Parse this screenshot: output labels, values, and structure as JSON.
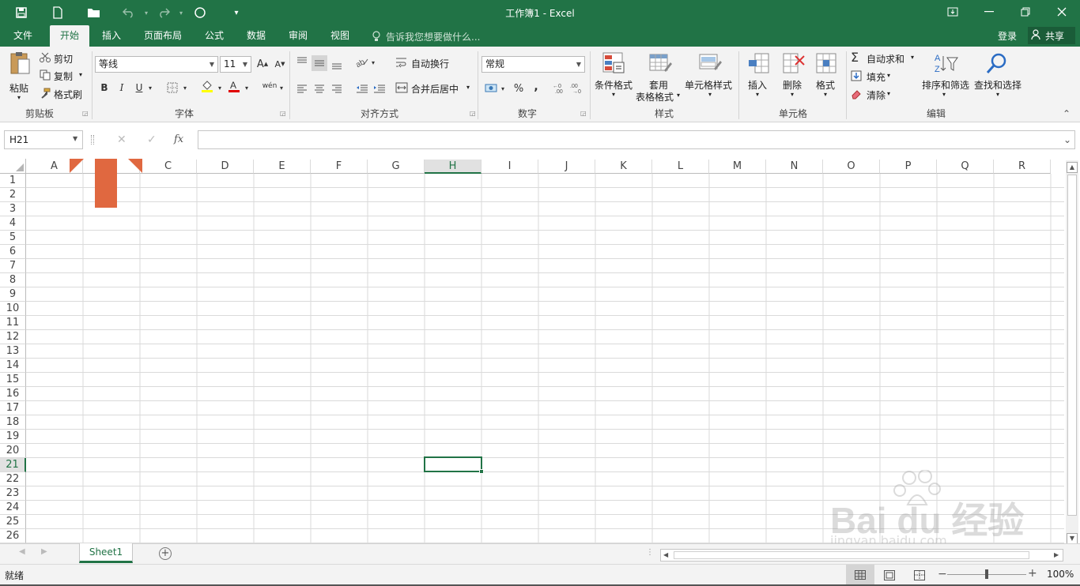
{
  "window": {
    "title": "工作簿1 - Excel"
  },
  "tabs": [
    "文件",
    "开始",
    "插入",
    "页面布局",
    "公式",
    "数据",
    "审阅",
    "视图"
  ],
  "tell_me": "告诉我您想要做什么...",
  "account": {
    "login": "登录",
    "share": "共享"
  },
  "ribbon": {
    "clipboard": {
      "paste": "粘贴",
      "cut": "剪切",
      "copy": "复制",
      "format_painter": "格式刷",
      "label": "剪贴板"
    },
    "font": {
      "name": "等线",
      "size": "11",
      "bold": "B",
      "italic": "I",
      "underline": "U",
      "grow": "A",
      "shrink": "A",
      "phonetic": "wén",
      "label": "字体"
    },
    "alignment": {
      "wrap": "自动换行",
      "merge": "合并后居中",
      "label": "对齐方式"
    },
    "number": {
      "format": "常规",
      "percent": "%",
      "comma": ",",
      "label": "数字"
    },
    "styles": {
      "conditional": "条件格式",
      "table1": "套用",
      "table2": "表格格式",
      "cell_styles": "单元格样式",
      "label": "样式"
    },
    "cells": {
      "insert": "插入",
      "delete": "删除",
      "format": "格式",
      "label": "单元格"
    },
    "editing": {
      "autosum": "自动求和",
      "fill": "填充",
      "clear": "清除",
      "sort": "排序和筛选",
      "find": "查找和选择",
      "label": "编辑"
    }
  },
  "formula_bar": {
    "name_box": "H21",
    "fx": "fx",
    "content": ""
  },
  "grid": {
    "columns": [
      "A",
      "B",
      "C",
      "D",
      "E",
      "F",
      "G",
      "H",
      "I",
      "J",
      "K",
      "L",
      "M",
      "N",
      "O",
      "P",
      "Q",
      "R"
    ],
    "rows": [
      "1",
      "2",
      "3",
      "4",
      "5",
      "6",
      "7",
      "8",
      "9",
      "10",
      "11",
      "12",
      "13",
      "14",
      "15",
      "16",
      "17",
      "18",
      "19",
      "20",
      "21",
      "22",
      "23",
      "24",
      "25",
      "26"
    ],
    "selected_column": "H",
    "selected_row": "21"
  },
  "sheets": [
    "Sheet1"
  ],
  "status": {
    "ready": "就绪",
    "zoom": "100%"
  },
  "colors": {
    "brand": "#217346",
    "arrow": "#e06840"
  },
  "watermark": {
    "brand": "Bai du 经验",
    "url": "jingyan.baidu.com"
  }
}
